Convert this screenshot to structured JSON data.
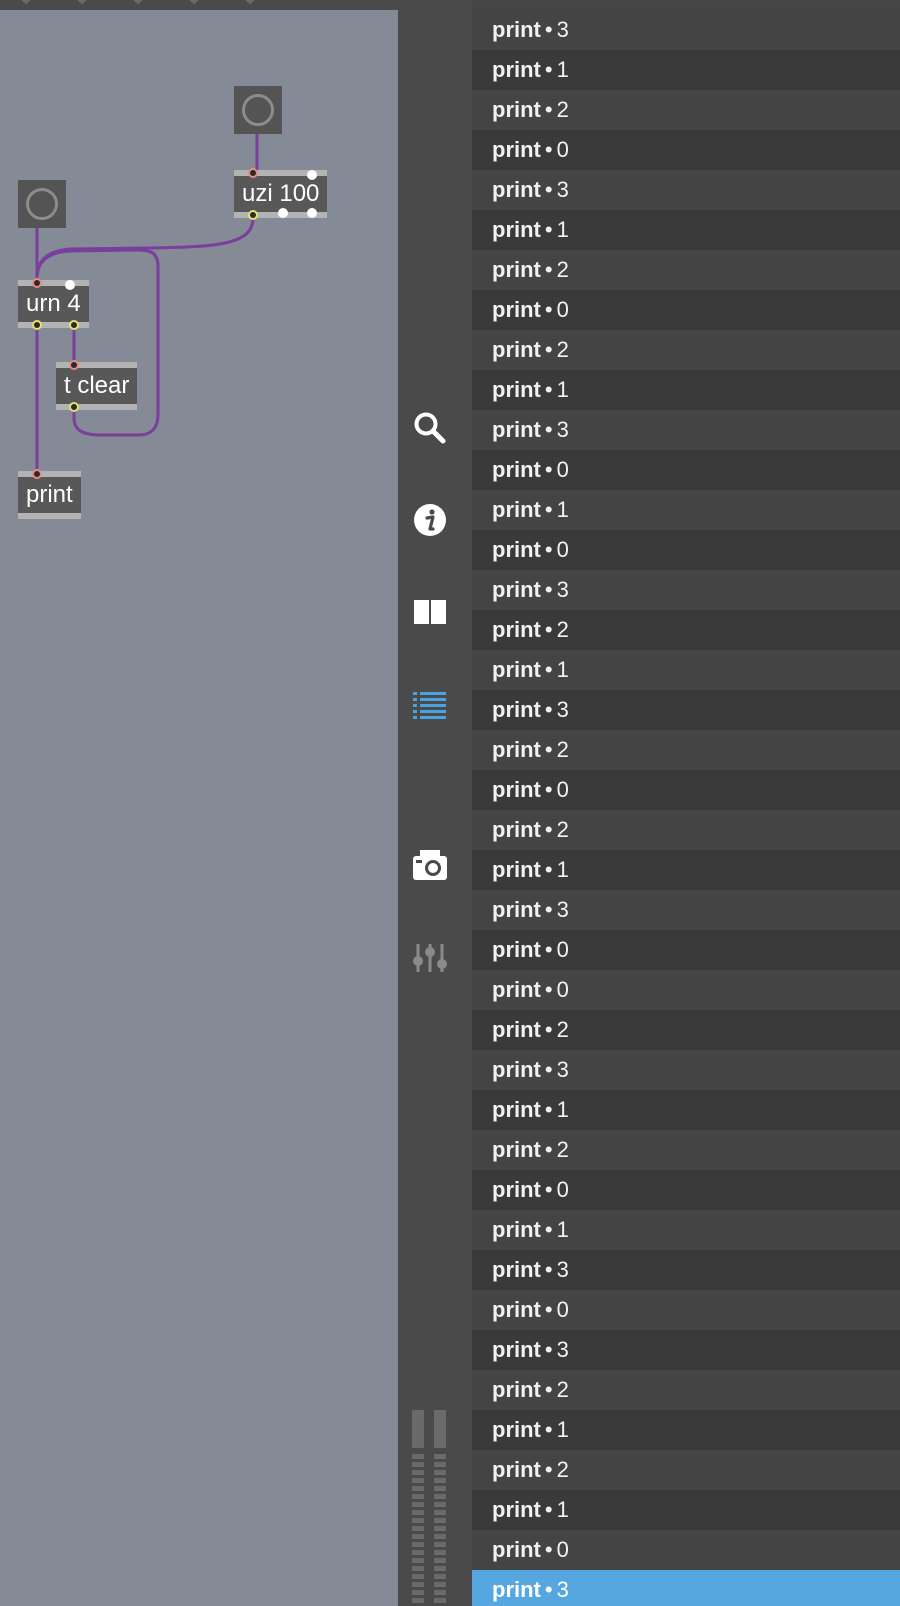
{
  "patcher": {
    "toggles": [
      {
        "name": "toggle-uzi"
      },
      {
        "name": "toggle-urn"
      }
    ],
    "objects": {
      "uzi": "uzi 100",
      "urn": "urn 4",
      "tclear": "t clear",
      "print": "print"
    }
  },
  "toolbar": {
    "icons": [
      "search-icon",
      "info-icon",
      "panes-icon",
      "console-list-icon",
      "camera-icon",
      "mixer-sliders-icon"
    ],
    "active_color": "#4aa3e0"
  },
  "console": {
    "separator": "•",
    "selected_color": "#56a7e0",
    "rows": [
      {
        "source": "print",
        "value": "3"
      },
      {
        "source": "print",
        "value": "1"
      },
      {
        "source": "print",
        "value": "2"
      },
      {
        "source": "print",
        "value": "0"
      },
      {
        "source": "print",
        "value": "3"
      },
      {
        "source": "print",
        "value": "1"
      },
      {
        "source": "print",
        "value": "2"
      },
      {
        "source": "print",
        "value": "0"
      },
      {
        "source": "print",
        "value": "2"
      },
      {
        "source": "print",
        "value": "1"
      },
      {
        "source": "print",
        "value": "3"
      },
      {
        "source": "print",
        "value": "0"
      },
      {
        "source": "print",
        "value": "1"
      },
      {
        "source": "print",
        "value": "0"
      },
      {
        "source": "print",
        "value": "3"
      },
      {
        "source": "print",
        "value": "2"
      },
      {
        "source": "print",
        "value": "1"
      },
      {
        "source": "print",
        "value": "3"
      },
      {
        "source": "print",
        "value": "2"
      },
      {
        "source": "print",
        "value": "0"
      },
      {
        "source": "print",
        "value": "2"
      },
      {
        "source": "print",
        "value": "1"
      },
      {
        "source": "print",
        "value": "3"
      },
      {
        "source": "print",
        "value": "0"
      },
      {
        "source": "print",
        "value": "0"
      },
      {
        "source": "print",
        "value": "2"
      },
      {
        "source": "print",
        "value": "3"
      },
      {
        "source": "print",
        "value": "1"
      },
      {
        "source": "print",
        "value": "2"
      },
      {
        "source": "print",
        "value": "0"
      },
      {
        "source": "print",
        "value": "1"
      },
      {
        "source": "print",
        "value": "3"
      },
      {
        "source": "print",
        "value": "0"
      },
      {
        "source": "print",
        "value": "3"
      },
      {
        "source": "print",
        "value": "2"
      },
      {
        "source": "print",
        "value": "1"
      },
      {
        "source": "print",
        "value": "2"
      },
      {
        "source": "print",
        "value": "1"
      },
      {
        "source": "print",
        "value": "0"
      },
      {
        "source": "print",
        "value": "3",
        "selected": true
      }
    ]
  }
}
